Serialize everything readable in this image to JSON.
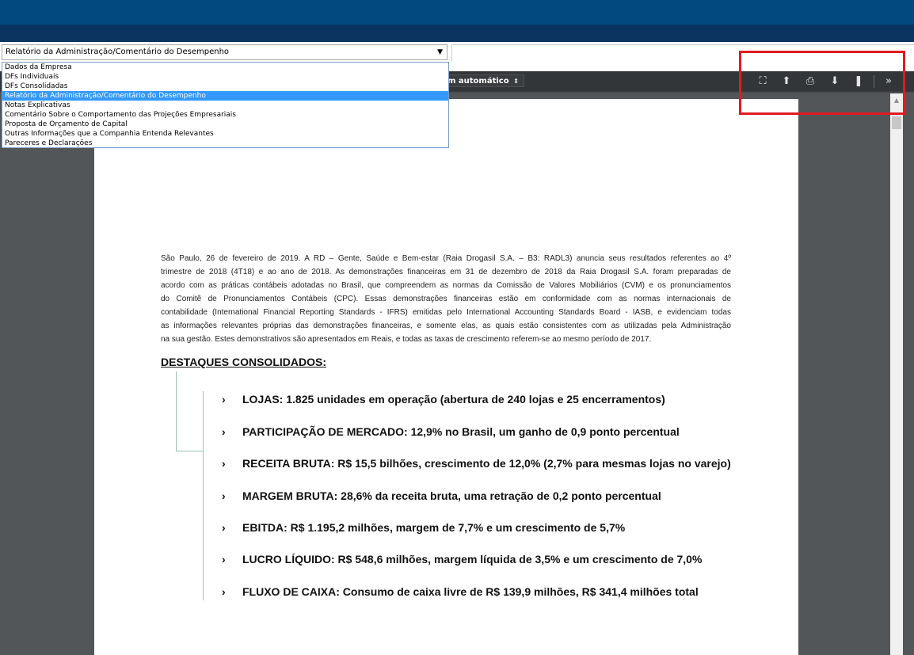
{
  "form": {
    "selected": "Relatório da Administração/Comentário do Desempenho",
    "options": [
      "Dados da Empresa",
      "DFs Individuais",
      "DFs Consolidadas",
      "Relatório da Administração/Comentário do Desempenho",
      "Notas Explicativas",
      "Comentário Sobre o Comportamento das Projeções Empresariais",
      "Proposta de Orçamento de Capital",
      "Outras Informações que a Companhia Entenda Relevantes",
      "Pareceres e Declarações"
    ],
    "selected_index": 3
  },
  "toolbar": {
    "zoom": "m automático",
    "icons": [
      "presentation-mode-icon",
      "open-file-icon",
      "print-icon",
      "download-icon",
      "bookmark-icon",
      "tools-icon"
    ],
    "icon_glyphs": [
      "⛶",
      "⬆",
      "⎙",
      "⬇",
      "❚",
      "»"
    ]
  },
  "document": {
    "paragraph_lines": [
      "São Paulo, 26 de fevereiro de 2019. A RD – Gente, Saúde e Bem-estar (Raia Drogasil S.A. – B3: RADL3) anuncia seus resultados referentes ao 4º",
      "trimestre de 2018 (4T18) e ao ano de 2018. As demonstrações financeiras em 31 de dezembro de 2018 da Raia Drogasil S.A. foram preparadas de",
      "acordo com as práticas contábeis adotadas no Brasil, que compreendem as normas da Comissão de Valores Mobiliários (CVM) e os pronunciamentos",
      "do Comitê de Pronunciamentos Contábeis (CPC). Essas demonstrações financeiras estão em conformidade com as normas internacionais de",
      "contabilidade (International Financial Reporting Standards - IFRS) emitidas pelo International Accounting Standards Board - IASB, e evidenciam todas",
      "as informações relevantes próprias das demonstrações financeiras, e somente elas, as quais estão consistentes com as utilizadas pela Administração",
      "na sua gestão. Estes demonstrativos são apresentados em Reais, e todas as taxas de crescimento referem-se ao mesmo período de 2017."
    ],
    "heading": "DESTAQUES CONSOLIDADOS:",
    "bullet_marker": "›",
    "highlights": [
      "LOJAS: 1.825 unidades em operação (abertura de 240 lojas e 25 encerramentos)",
      "PARTICIPAÇÃO DE MERCADO: 12,9% no Brasil, um ganho de 0,9 ponto percentual",
      "RECEITA BRUTA: R$ 15,5 bilhões, crescimento de 12,0% (2,7% para mesmas lojas no varejo)",
      "MARGEM BRUTA: 28,6% da receita bruta, uma retração de 0,2 ponto percentual",
      "EBITDA: R$ 1.195,2 milhões, margem de 7,7% e um crescimento de 5,7%",
      "LUCRO LÍQUIDO: R$ 548,6 milhões, margem líquida de 3,5% e um crescimento de 7,0%",
      "FLUXO DE CAIXA: Consumo de caixa livre de R$ 139,9 milhões, R$ 341,4 milhões total"
    ]
  },
  "colors": {
    "header": "#02497f",
    "viewer_bg": "#525659",
    "toolbar": "#323639",
    "highlight_box": "#e01b22",
    "selection": "#3399ff"
  }
}
